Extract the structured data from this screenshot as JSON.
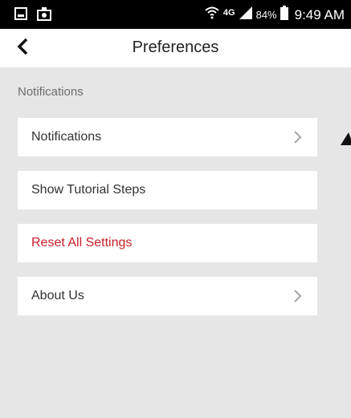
{
  "status_bar": {
    "network_label": "4G",
    "battery_percent": "84%",
    "time": "9:49 AM",
    "icons": [
      "gallery-icon",
      "photo-upload-icon",
      "wifi-icon",
      "signal-icon",
      "battery-icon"
    ]
  },
  "header": {
    "back_icon": "chevron-left-icon",
    "title": "Preferences"
  },
  "section": {
    "label": "Notifications"
  },
  "menu": {
    "items": [
      {
        "label": "Notifications",
        "has_chevron": true
      },
      {
        "label": "Show Tutorial Steps",
        "has_chevron": false
      },
      {
        "label": "Reset All Settings",
        "has_chevron": false,
        "color": "#c8202b"
      },
      {
        "label": "About Us",
        "has_chevron": true
      }
    ]
  },
  "colors": {
    "background": "#e6e6e6",
    "card": "#ffffff",
    "danger": "#c8202b",
    "status_bar": "#000000"
  }
}
